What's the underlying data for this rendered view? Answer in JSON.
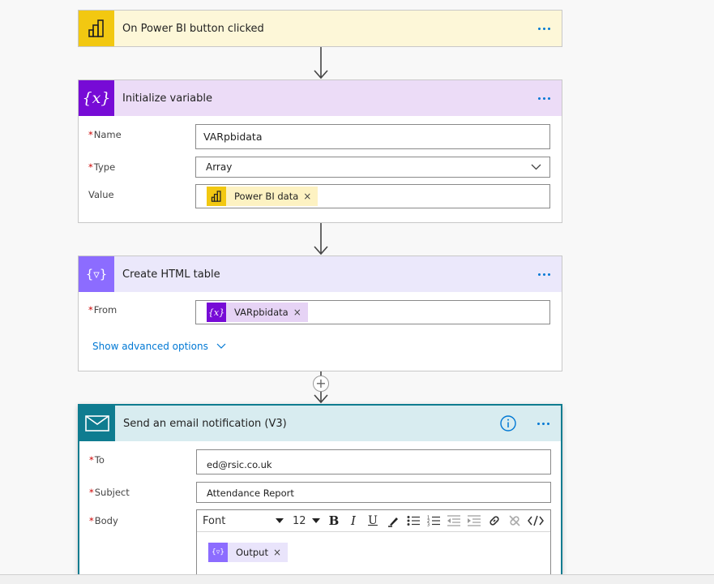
{
  "trigger": {
    "title": "On Power BI button clicked",
    "icon": "power-bi-icon",
    "color": "#fdf7d8",
    "icon_bg": "#f2c811"
  },
  "init_variable": {
    "title": "Initialize variable",
    "icon": "variable-icon",
    "header_color": "#ecdcf7",
    "icon_bg": "#770bd6",
    "name_label": "Name",
    "name_value": "VARpbidata",
    "type_label": "Type",
    "type_value": "Array",
    "value_label": "Value",
    "value_token": "Power BI data"
  },
  "html_table": {
    "title": "Create HTML table",
    "icon": "data-operation-icon",
    "header_color": "#ebe8fb",
    "icon_bg": "#8c6cff",
    "from_label": "From",
    "from_token": "VARpbidata",
    "advanced_label": "Show advanced options"
  },
  "email": {
    "title": "Send an email notification (V3)",
    "icon": "mail-icon",
    "header_color": "#d8ecf0",
    "accent": "#0f7c90",
    "to_label": "To",
    "to_value": "ed@rsic.co.uk",
    "subject_label": "Subject",
    "subject_value": "Attendance Report",
    "body_label": "Body",
    "font_value": "Font",
    "size_value": "12",
    "body_token": "Output"
  }
}
